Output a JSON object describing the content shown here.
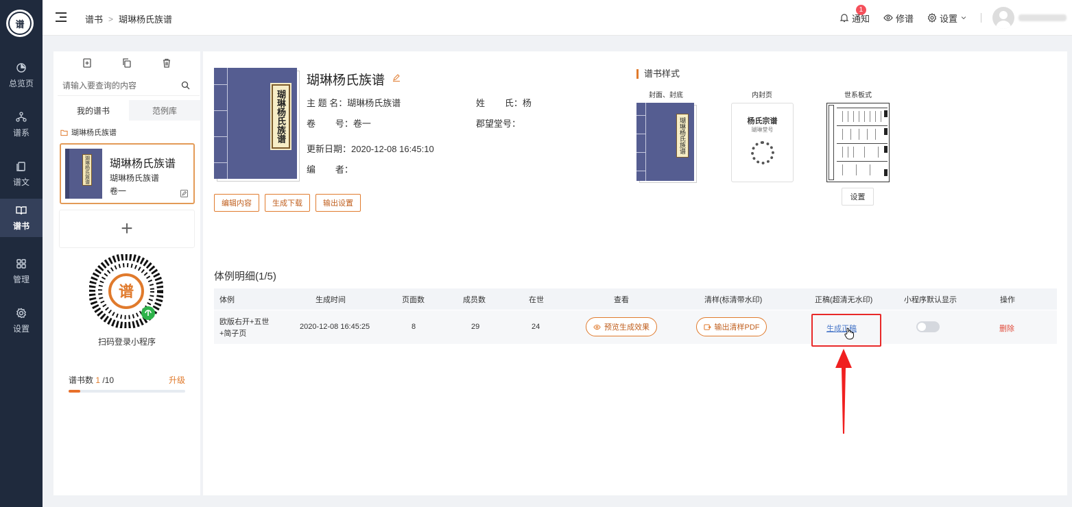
{
  "nav": {
    "logo_text": "谱",
    "items": [
      {
        "label": "总览页",
        "icon": "pie-chart-icon"
      },
      {
        "label": "谱系",
        "icon": "tree-icon"
      },
      {
        "label": "谱文",
        "icon": "document-icon"
      },
      {
        "label": "谱书",
        "icon": "book-icon",
        "active": true
      },
      {
        "label": "管理",
        "icon": "grid-icon"
      },
      {
        "label": "设置",
        "icon": "gear-icon"
      }
    ]
  },
  "header": {
    "breadcrumb": [
      "谱书",
      "瑚琳杨氏族谱"
    ],
    "notify_label": "通知",
    "notify_badge": "1",
    "edit_label": "修谱",
    "settings_label": "设置"
  },
  "left": {
    "search_placeholder": "请输入要查询的内容",
    "tabs": [
      "我的谱书",
      "范例库"
    ],
    "folder": "瑚琳杨氏族谱",
    "card": {
      "title": "瑚琳杨氏族谱",
      "subtitle": "瑚琳杨氏族谱",
      "volume": "卷一",
      "cover_label": "瑚琳杨氏族谱"
    },
    "add_symbol": "+",
    "qr_label": "扫码登录小程序",
    "count_label": "谱书数",
    "count_used": "1",
    "count_total": "/10",
    "upgrade": "升级",
    "usage_fraction": 0.1
  },
  "book": {
    "cover_label": "瑚琳杨氏族谱",
    "title": "瑚琳杨氏族谱",
    "topic": "主  题  名：瑚琳杨氏族谱",
    "surname": "姓        氏：杨",
    "volume": "卷        号：卷一",
    "hall": "郡望堂号：",
    "updated": "更新日期：2020-12-08 16:45:10",
    "editor": "编        者：",
    "buttons": [
      "编辑内容",
      "生成下载",
      "输出设置"
    ]
  },
  "style": {
    "title": "谱书样式",
    "thumbs": [
      "封面、封底",
      "内封页",
      "世系板式"
    ],
    "inner_title": "杨氏宗谱",
    "inner_sub": "瑚琳堂号",
    "settings_btn": "设置"
  },
  "detail": {
    "title": "体例明细(1/5)",
    "columns": [
      "体例",
      "生成时间",
      "页面数",
      "成员数",
      "在世",
      "查看",
      "清样(标清带水印)",
      "正稿(超清无水印)",
      "小程序默认显示",
      "操作"
    ],
    "row": {
      "style_line1": "欧版右开+五世",
      "style_line2": "+简子页",
      "time": "2020-12-08 16:45:25",
      "pages": "8",
      "members": "29",
      "alive": "24",
      "preview": "预览生成效果",
      "proof": "输出清样PDF",
      "final": "生成正稿",
      "mini_default": false,
      "delete": "删除"
    }
  }
}
